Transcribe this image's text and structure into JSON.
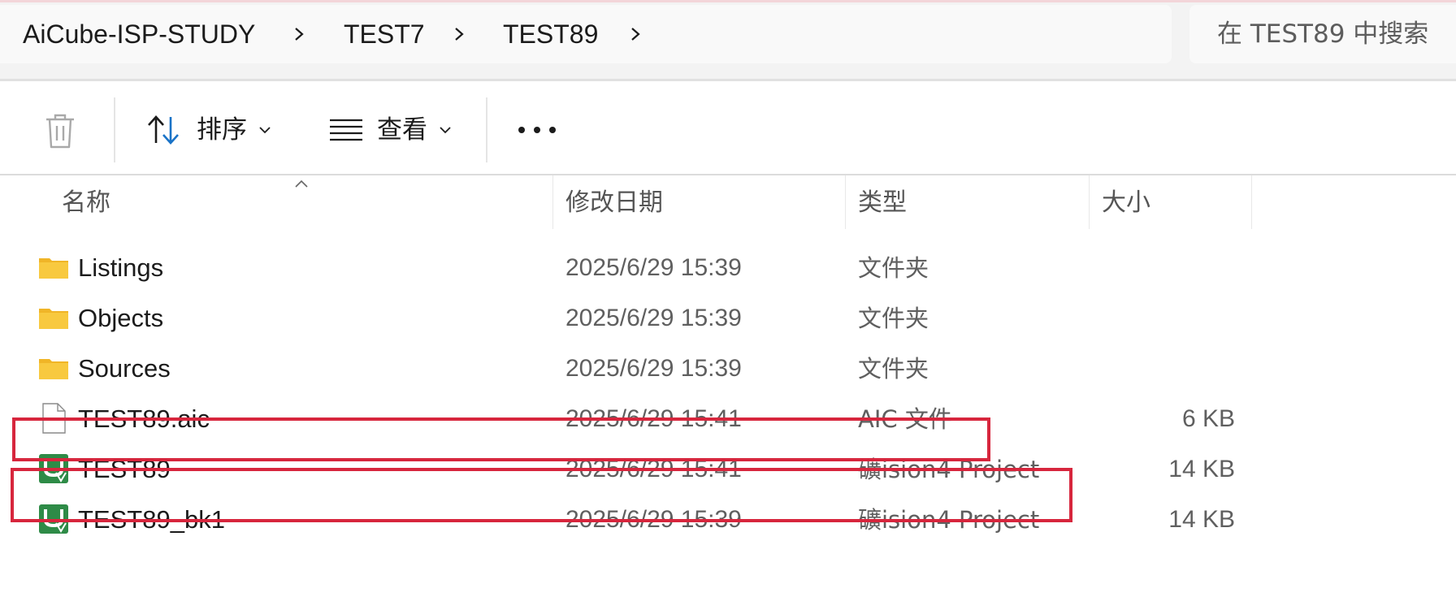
{
  "address_bar": {
    "breadcrumb": [
      {
        "label": "AiCube-ISP-STUDY"
      },
      {
        "label": "TEST7"
      },
      {
        "label": "TEST89"
      }
    ]
  },
  "search": {
    "placeholder": "在 TEST89 中搜索",
    "value": ""
  },
  "command_bar": {
    "delete_icon": "trash-icon",
    "sort_label": "排序",
    "view_label": "查看",
    "more_icon": "ellipsis-icon"
  },
  "columns": {
    "name": "名称",
    "modified": "修改日期",
    "type": "类型",
    "size": "大小"
  },
  "files": [
    {
      "name": "Listings",
      "modified": "2025/6/29 15:39",
      "type": "文件夹",
      "size": "",
      "icon": "folder-icon",
      "highlighted": false
    },
    {
      "name": "Objects",
      "modified": "2025/6/29 15:39",
      "type": "文件夹",
      "size": "",
      "icon": "folder-icon",
      "highlighted": false
    },
    {
      "name": "Sources",
      "modified": "2025/6/29 15:39",
      "type": "文件夹",
      "size": "",
      "icon": "folder-icon",
      "highlighted": false
    },
    {
      "name": "TEST89.aic",
      "modified": "2025/6/29 15:41",
      "type": "AIC 文件",
      "size": "6 KB",
      "icon": "file-icon",
      "highlighted": true
    },
    {
      "name": "TEST89",
      "modified": "2025/6/29 15:41",
      "type": "礦ision4 Project",
      "size": "14 KB",
      "icon": "uvision-project-icon",
      "highlighted": true
    },
    {
      "name": "TEST89_bk1",
      "modified": "2025/6/29 15:39",
      "type": "礦ision4 Project",
      "size": "14 KB",
      "icon": "uvision-project-icon",
      "highlighted": false
    }
  ],
  "colors": {
    "highlight": "#d7263d",
    "folder": "#f8c33a",
    "uvision": "#2e8b47",
    "sort_arrow": "#1a73c7"
  }
}
